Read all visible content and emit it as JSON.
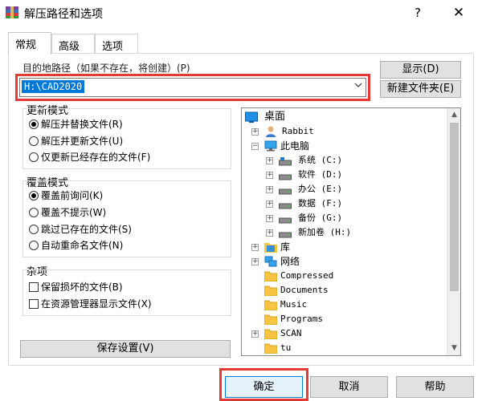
{
  "window": {
    "title": "解压路径和选项",
    "help": "?",
    "close": "✕"
  },
  "tabs": [
    "常规",
    "高级",
    "选项"
  ],
  "path": {
    "label": "目的地路径（如果不存在，将创建）(P)",
    "value": "H:\\CAD2020"
  },
  "buttons": {
    "show": "显示(D)",
    "new_folder": "新建文件夹(E)",
    "save": "保存设置(V)",
    "ok": "确定",
    "cancel": "取消",
    "help": "帮助"
  },
  "update_mode": {
    "title": "更新模式",
    "options": [
      {
        "label": "解压并替换文件(R)",
        "checked": true
      },
      {
        "label": "解压并更新文件(U)",
        "checked": false
      },
      {
        "label": "仅更新已经存在的文件(F)",
        "checked": false
      }
    ]
  },
  "overwrite_mode": {
    "title": "覆盖模式",
    "options": [
      {
        "label": "覆盖前询问(K)",
        "checked": true
      },
      {
        "label": "覆盖不提示(W)",
        "checked": false
      },
      {
        "label": "跳过已存在的文件(S)",
        "checked": false
      },
      {
        "label": "自动重命名文件(N)",
        "checked": false
      }
    ]
  },
  "misc": {
    "title": "杂项",
    "options": [
      {
        "label": "保留损坏的文件(B)",
        "checked": false
      },
      {
        "label": "在资源管理器显示文件(X)",
        "checked": false
      }
    ]
  },
  "tree": {
    "desktop": "桌面",
    "rabbit": "Rabbit",
    "this_pc": "此电脑",
    "drives": [
      "系统 (C:)",
      "软件 (D:)",
      "办公 (E:)",
      "数据 (F:)",
      "备份 (G:)",
      "新加卷 (H:)"
    ],
    "library": "库",
    "network": "网络",
    "folders": [
      "Compressed",
      "Documents",
      "Music",
      "Programs",
      "SCAN",
      "tu"
    ]
  }
}
